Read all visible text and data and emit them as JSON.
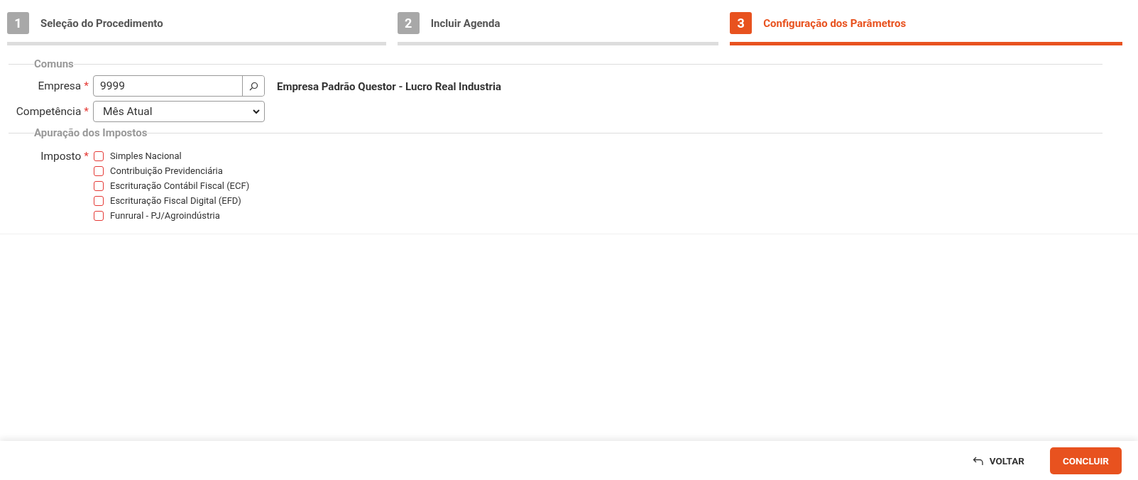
{
  "steps": [
    {
      "number": "1",
      "label": "Seleção do Procedimento",
      "selected": false
    },
    {
      "number": "2",
      "label": "Incluir Agenda",
      "selected": false
    },
    {
      "number": "3",
      "label": "Configuração dos Parâmetros",
      "selected": true
    }
  ],
  "sections": [
    {
      "title": "Comuns",
      "fields": [
        {
          "kind": "lookup",
          "label": "Empresa",
          "required_mark": "*",
          "value": "9999",
          "description": "Empresa Padrão Questor - Lucro Real Industria"
        },
        {
          "kind": "select",
          "label": "Competência",
          "required_mark": "*",
          "value": "Mês Atual"
        }
      ]
    },
    {
      "title": "Apuração dos Impostos",
      "fields": [
        {
          "kind": "checkboxes",
          "label": "Imposto",
          "required_mark": "*",
          "options": [
            {
              "label": "Simples Nacional",
              "checked": false
            },
            {
              "label": "Contribuição Previdenciária",
              "checked": false
            },
            {
              "label": "Escrituração Contábil Fiscal (ECF)",
              "checked": false
            },
            {
              "label": "Escrituração Fiscal Digital (EFD)",
              "checked": false
            },
            {
              "label": "Funrural - PJ/Agroindústria",
              "checked": false
            }
          ]
        }
      ]
    }
  ],
  "footer": {
    "back": "VOLTAR",
    "finish": "CONCLUIR"
  }
}
